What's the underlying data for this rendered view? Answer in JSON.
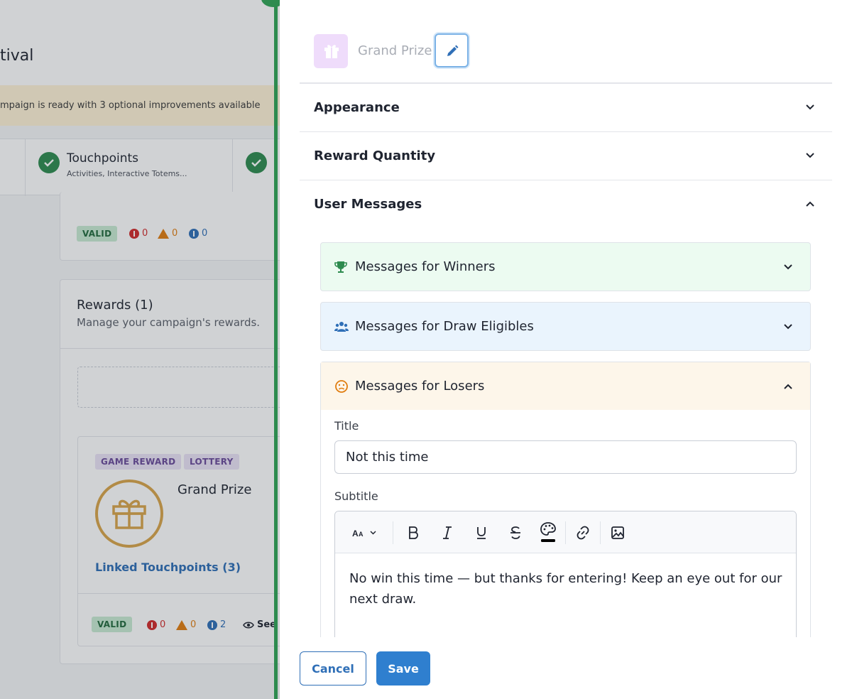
{
  "background": {
    "title_fragment": "tival",
    "banner_text": "mpaign is ready with 3 optional improvements available",
    "steps": [
      {
        "title": "Touchpoints",
        "subtitle": "Activities, Interactive Totems..."
      }
    ],
    "touchpoints_card": {
      "status": "VALID",
      "errors": "0",
      "warnings": "0",
      "infos": "0"
    },
    "rewards_card": {
      "title": "Rewards (1)",
      "subtitle": "Manage your campaign's rewards.",
      "reward": {
        "tags": [
          "GAME REWARD",
          "LOTTERY"
        ],
        "name": "Grand Prize",
        "linked": "Linked Touchpoints (3)",
        "status": "VALID",
        "errors": "0",
        "warnings": "0",
        "infos": "2",
        "see_label": "See"
      }
    }
  },
  "drawer": {
    "reward_name": "Grand Prize",
    "sections": [
      {
        "label": "Appearance",
        "expanded": false
      },
      {
        "label": "Reward Quantity",
        "expanded": false
      },
      {
        "label": "User Messages",
        "expanded": true
      }
    ],
    "message_groups": [
      {
        "label": "Messages for Winners",
        "icon": "trophy-icon",
        "color": "#ecfbf1",
        "expanded": false
      },
      {
        "label": "Messages for Draw Eligibles",
        "icon": "users-icon",
        "color": "#eaf4fd",
        "expanded": false
      },
      {
        "label": "Messages for Losers",
        "icon": "sad-face-icon",
        "color": "#fdf6ea",
        "expanded": true
      }
    ],
    "losers_form": {
      "title_label": "Title",
      "title_value": "Not this time",
      "subtitle_label": "Subtitle",
      "subtitle_value": "No win this time — but thanks for entering! Keep an eye out for our next draw."
    },
    "footer": {
      "cancel": "Cancel",
      "save": "Save"
    }
  },
  "colors": {
    "accent": "#2f7fcf",
    "success": "#2e8b4f",
    "banner": "#fff3d6"
  }
}
